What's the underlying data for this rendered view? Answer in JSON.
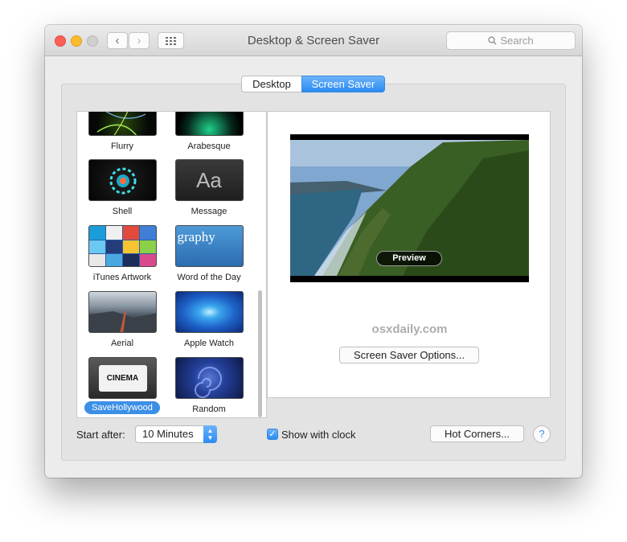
{
  "window": {
    "title": "Desktop & Screen Saver"
  },
  "toolbar": {
    "search_placeholder": "Search"
  },
  "tabs": [
    {
      "label": "Desktop"
    },
    {
      "label": "Screen Saver",
      "selected": true
    }
  ],
  "savers": [
    {
      "label": "Flurry"
    },
    {
      "label": "Arabesque"
    },
    {
      "label": "Shell"
    },
    {
      "label": "Message",
      "thumb_text": "Aa"
    },
    {
      "label": "iTunes Artwork"
    },
    {
      "label": "Word of the Day",
      "thumb_text": "graphy"
    },
    {
      "label": "Aerial"
    },
    {
      "label": "Apple Watch"
    },
    {
      "label": "SaveHollywood",
      "thumb_text": "CINEMA",
      "selected": true
    },
    {
      "label": "Random"
    }
  ],
  "preview": {
    "button_label": "Preview"
  },
  "watermark": "osxdaily.com",
  "options_button": "Screen Saver Options...",
  "start_after": {
    "label": "Start after:",
    "value": "10 Minutes"
  },
  "show_clock": {
    "label": "Show with clock",
    "checked": true
  },
  "hot_corners_button": "Hot Corners...",
  "help": "?",
  "colors": {
    "accent": "#3c8fe6",
    "close": "#fc5f57",
    "minimize": "#fdbc2e"
  }
}
